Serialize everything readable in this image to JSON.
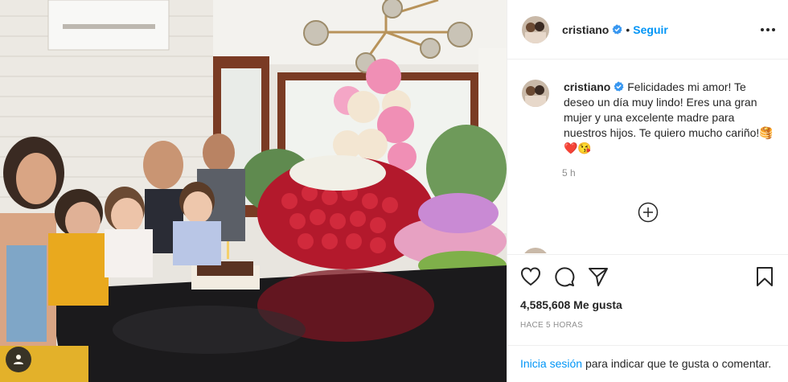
{
  "post": {
    "username": "cristiano",
    "follow_label": "Seguir",
    "dot": "•",
    "caption": "Felicidades mi amor! Te deseo un día muy lindo! Eres una gran mujer y una excelente madre para nuestros hijos. Te quiero mucho cariño!🥞❤️😘",
    "relative_time": "5 h",
    "likes": "4,585,608 Me gusta",
    "posted_ago": "HACE 5 HORAS",
    "login_link": "Inicia sesión",
    "login_rest": "para indicar que te gusta o comentar."
  },
  "icons": [
    "more-options-icon",
    "verified-badge-icon",
    "load-more-comments-icon",
    "like-heart-icon",
    "comment-icon",
    "share-icon",
    "save-bookmark-icon",
    "user-tag-icon"
  ],
  "colors": {
    "accent": "#0095f6",
    "text": "#262626",
    "muted": "#8e8e8e",
    "border": "#efefef"
  }
}
